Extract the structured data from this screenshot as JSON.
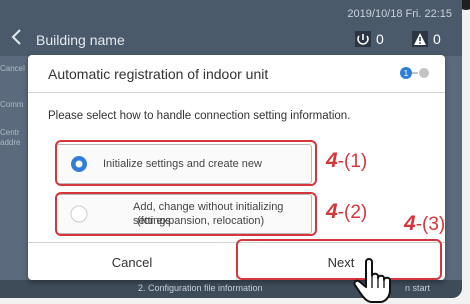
{
  "header": {
    "datetime": "2019/10/18 Fri. 22:15",
    "back_icon": "chevron-left-icon",
    "building_name": "Building name",
    "status": [
      {
        "icon": "power-icon",
        "count": "0"
      },
      {
        "icon": "warning-icon",
        "count": "0"
      }
    ]
  },
  "sidebar": {
    "items": [
      "Cancel",
      "Comm",
      "Centr",
      "addre"
    ]
  },
  "dialog": {
    "title": "Automatic registration of indoor unit",
    "step_indicator": {
      "current": "1",
      "total": 2
    },
    "instruction": "Please select how to handle connection setting information.",
    "options": [
      {
        "label": "Initialize settings and create new",
        "selected": true
      },
      {
        "label_line1": "Add, change without initializing settings",
        "label_line2": "(for expansion, relocation)",
        "selected": false
      }
    ],
    "buttons": {
      "cancel": "Cancel",
      "next": "Next"
    }
  },
  "annotations": [
    {
      "num": "4",
      "suffix": "-(1)"
    },
    {
      "num": "4",
      "suffix": "-(2)"
    },
    {
      "num": "4",
      "suffix": "-(3)"
    }
  ],
  "footer": {
    "step_text": "2. Configuration file information",
    "button_text": "n start"
  },
  "colors": {
    "accent": "#2f7fd8",
    "annotation": "#d6363b",
    "screen_bg": "#5b6b7d"
  }
}
